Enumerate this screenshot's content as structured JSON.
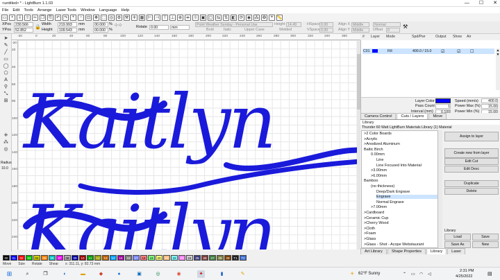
{
  "window": {
    "title": "<untitled> * - LightBurn 1.1.03",
    "controls": [
      "—",
      "☐",
      "✕"
    ]
  },
  "menu": [
    "File",
    "Edit",
    "Tools",
    "Arrange",
    "Laser Tools",
    "Window",
    "Language",
    "Help"
  ],
  "props": {
    "xpos_label": "XPos",
    "xpos": "230.566",
    "ypos_label": "YPos",
    "ypos": "52.852",
    "width_label": "Width",
    "width": "219.993",
    "height_label": "Height",
    "height": "109.543",
    "unit1": "mm",
    "unit2": "mm",
    "scale_w": "00.000",
    "scale_h": "00.000",
    "pct1": "%",
    "pct2": "%",
    "rotate_label": "Rotate",
    "rotate": "0.00",
    "rotate_unit": "mm",
    "font": "Point Weather Sunday - Personal Use",
    "bold": "Bold",
    "italic": "Italic",
    "upper": "Upper Case",
    "welded": "Welded",
    "height2_label": "Height",
    "height2": "14.49",
    "hspace_label": "HSpace",
    "hspace": "0.00",
    "vspace_label": "VSpace",
    "vspace": "0.00",
    "alignx_label": "Align X",
    "alignx": "Middle",
    "aligny_label": "Align Y",
    "aligny": "Middle",
    "normal": "Normal",
    "offset_label": "Offset",
    "offset": "0"
  },
  "ruler": {
    "top": [
      "0",
      "20",
      "40",
      "60",
      "80",
      "100",
      "120",
      "140",
      "160",
      "180",
      "200",
      "220",
      "240",
      "260",
      "280",
      "300",
      "320",
      "340",
      "360",
      "380"
    ],
    "left": [
      "20",
      "40",
      "60",
      "80",
      "100",
      "120",
      "140",
      "160",
      "180",
      "200",
      "220",
      "240",
      "260",
      "280",
      "300"
    ],
    "top_neg": "-20",
    "left_neg": "-20"
  },
  "radius": {
    "label": "Radius",
    "value": "10.0"
  },
  "canvas_text": {
    "line1": "Kaitlyn",
    "line2": "Kaitlyn",
    "color": "#1a1adb"
  },
  "cuts": {
    "panel_title": "Cuts / Layers",
    "columns": [
      "#",
      "Layer",
      "Mode",
      "Spd/Pwr",
      "Output",
      "Show",
      "Air"
    ],
    "rows": [
      {
        "num": "C01",
        "mode": "Fill",
        "spdpwr": "400.0 / 15.0"
      }
    ],
    "layer_color_label": "Layer Color",
    "pass_count_label": "Pass Count",
    "pass_count": "1",
    "interval_label": "Interval (mm)",
    "interval": "0.100",
    "speed_label": "Speed (mm/s)",
    "speed": "400.0",
    "pmax_label": "Power Max (%)",
    "pmax": "15.00",
    "pmin_label": "Power Min (%)",
    "pmin": "15.00",
    "layer_color": "#0000ff"
  },
  "tabs_top": [
    "Camera Control",
    "Cuts / Layers",
    "Move"
  ],
  "library": {
    "title": "Library",
    "header": "Thunder 60 Watt LightBurn Materials Library (1) Material",
    "tree": [
      {
        "label": ">2 Color Boards",
        "indent": 0
      },
      {
        "label": ">Acrylic",
        "indent": 0
      },
      {
        "label": ">Anodized Aluminum",
        "indent": 0
      },
      {
        "label": "Baltic Birch",
        "indent": 0
      },
      {
        "label": "0.00mm",
        "indent": 1
      },
      {
        "label": "Line",
        "indent": 2
      },
      {
        "label": "Line Focused Into Material",
        "indent": 2
      },
      {
        "label": ">3.00mm",
        "indent": 1
      },
      {
        "label": ">6.00mm",
        "indent": 1
      },
      {
        "label": "Bamboo",
        "indent": 0
      },
      {
        "label": "(no thickness)",
        "indent": 1
      },
      {
        "label": "Deep/Dark Engrave",
        "indent": 2
      },
      {
        "label": "Engrave",
        "indent": 2
      },
      {
        "label": "Normal Engrave",
        "indent": 2
      },
      {
        "label": ">7.00mm",
        "indent": 1
      },
      {
        "label": ">Cardboard",
        "indent": 0
      },
      {
        "label": ">Ceramic Cup",
        "indent": 0
      },
      {
        "label": ">Cherry Wood",
        "indent": 0
      },
      {
        "label": ">Cloth",
        "indent": 0
      },
      {
        "label": ">Foam",
        "indent": 0
      },
      {
        "label": ">Glass",
        "indent": 0
      },
      {
        "label": ">Glass - Shot - Acope Webstaurant",
        "indent": 0
      }
    ],
    "buttons": {
      "assign": "Assign to layer",
      "create": "Create new from layer",
      "edit_cut": "Edit Cut",
      "edit_desc": "Edit Desc",
      "duplicate": "Duplicate",
      "delete": "Delete",
      "library_label": "Library",
      "load": "Load",
      "save": "Save",
      "save_as": "Save As",
      "new": "New"
    }
  },
  "tabs_bottom": [
    "Art Library",
    "Shape Properties",
    "Library",
    "Laser"
  ],
  "palette": [
    {
      "label": "00",
      "color": "#000000"
    },
    {
      "label": "01",
      "color": "#0000ff"
    },
    {
      "label": "02",
      "color": "#ff0000"
    },
    {
      "label": "03",
      "color": "#00c000"
    },
    {
      "label": "04",
      "color": "#d0d000"
    },
    {
      "label": "05",
      "color": "#ff8000"
    },
    {
      "label": "06",
      "color": "#00c0c0"
    },
    {
      "label": "07",
      "color": "#ff00ff"
    },
    {
      "label": "08",
      "color": "#b0b0b0"
    },
    {
      "label": "09",
      "color": "#0000a0"
    },
    {
      "label": "10",
      "color": "#a00000"
    },
    {
      "label": "11",
      "color": "#00a000"
    },
    {
      "label": "12",
      "color": "#a0a000"
    },
    {
      "label": "13",
      "color": "#c06000"
    },
    {
      "label": "14",
      "color": "#00a0ff"
    },
    {
      "label": "15",
      "color": "#a000a0"
    },
    {
      "label": "16",
      "color": "#808080"
    },
    {
      "label": "17",
      "color": "#7d87ff"
    },
    {
      "label": "18",
      "color": "#ff7d7d"
    },
    {
      "label": "19",
      "color": "#7dff7d"
    },
    {
      "label": "20",
      "color": "#ffff7d"
    },
    {
      "label": "21",
      "color": "#ffbe7d"
    },
    {
      "label": "22",
      "color": "#7dffff"
    },
    {
      "label": "23",
      "color": "#ff7dff"
    },
    {
      "label": "24",
      "color": "#d0d0d0"
    },
    {
      "label": "25",
      "color": "#404080"
    },
    {
      "label": "26",
      "color": "#804040"
    },
    {
      "label": "27",
      "color": "#408040"
    },
    {
      "label": "28",
      "color": "#808040"
    },
    {
      "label": "29",
      "color": "#804000"
    },
    {
      "label": "T1",
      "color": "#202020"
    },
    {
      "label": "T2",
      "color": "#3a6ad0"
    }
  ],
  "status": [
    "Move",
    "Size",
    "Rotate",
    "Shear"
  ],
  "status_coords": "x: 311.11, y: 82.73 mm",
  "taskbar": {
    "weather": "62°F Sunny",
    "time": "2:31 PM",
    "date": "4/25/2022"
  }
}
